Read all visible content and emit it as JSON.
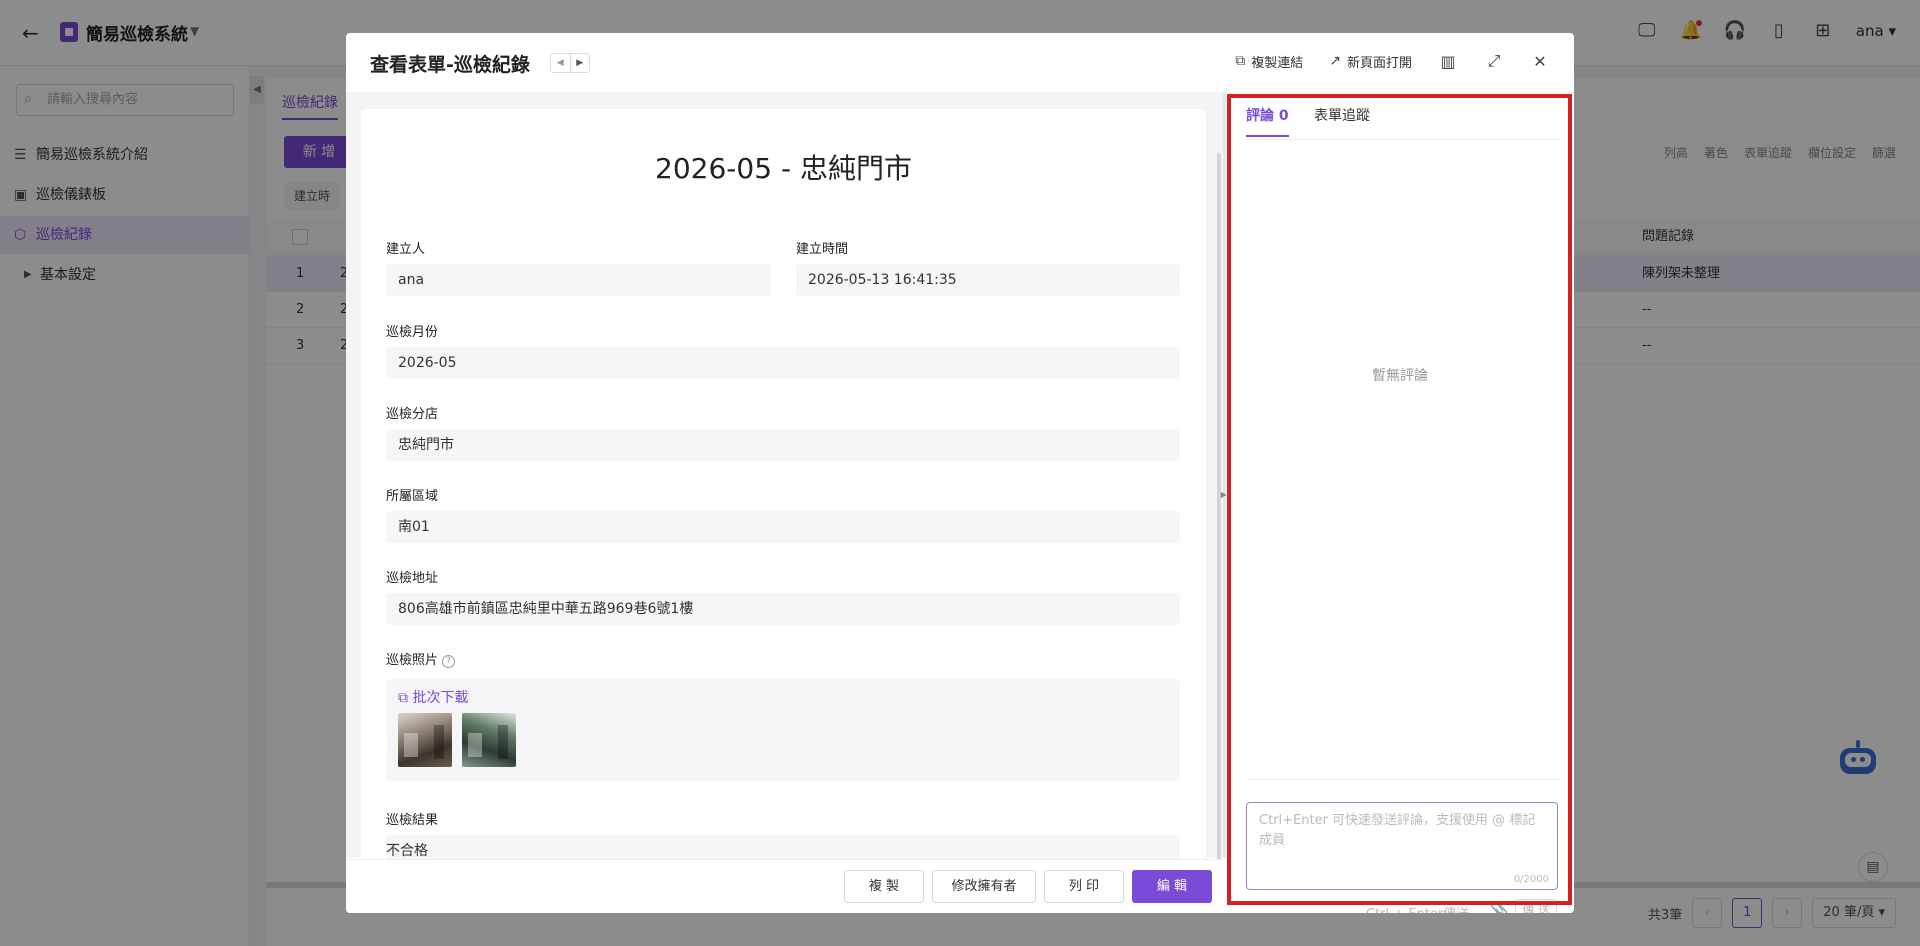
{
  "app": {
    "title": "簡易巡檢系統",
    "user": "ana"
  },
  "sidebar": {
    "search_placeholder": "請輸入搜尋內容",
    "items": [
      {
        "label": "簡易巡檢系統介紹"
      },
      {
        "label": "巡檢儀錶板"
      },
      {
        "label": "巡檢紀錄"
      },
      {
        "label": "基本設定"
      }
    ]
  },
  "content": {
    "tab": "巡檢紀錄",
    "add_button": "新 增",
    "filter_chip": "建立時",
    "tools": [
      "列高",
      "著色",
      "表單追蹤",
      "欄位設定",
      "篩選"
    ],
    "table": {
      "last_column_header": "問題記錄",
      "rows": [
        {
          "index": "1",
          "col2": "2",
          "issue": "陳列架未整理"
        },
        {
          "index": "2",
          "col2": "2",
          "issue": "--"
        },
        {
          "index": "3",
          "col2": "2",
          "issue": "--"
        }
      ]
    },
    "pager": {
      "total": "共3筆",
      "current": "1",
      "page_size": "20 筆/頁"
    }
  },
  "modal": {
    "title": "查看表單-巡檢紀錄",
    "actions": {
      "copy_link": "複製連結",
      "open_new_page": "新頁面打開"
    },
    "form": {
      "title": "2026-05 - 忠純門市",
      "creator_label": "建立人",
      "creator": "ana",
      "created_time_label": "建立時間",
      "created_time": "2026-05-13 16:41:35",
      "month_label": "巡檢月份",
      "month": "2026-05",
      "store_label": "巡檢分店",
      "store": "忠純門市",
      "region_label": "所屬區域",
      "region": "南01",
      "address_label": "巡檢地址",
      "address": "806高雄市前鎮區忠純里中華五路969巷6號1樓",
      "photos_label": "巡檢照片",
      "batch_download": "批次下載",
      "result_label": "巡檢結果",
      "result": "不合格"
    },
    "footer": {
      "copy": "複 製",
      "change_owner": "修改擁有者",
      "print": "列 印",
      "edit": "編 輯"
    },
    "comments": {
      "tab_comments": "評論 0",
      "tab_tracking": "表單追蹤",
      "empty": "暫無評論",
      "placeholder": "Ctrl+Enter 可快速發送評論，支援使用 @ 標記成員",
      "counter": "0/2000",
      "send_hint": "Ctrl + Enter傳送",
      "send_button": "傳 送"
    }
  },
  "colors": {
    "accent": "#7a4bd6",
    "highlight": "#d71f1f"
  },
  "icons": [
    "back-icon",
    "app-logo-icon",
    "caret-down-icon",
    "monitor-icon",
    "bell-icon",
    "headset-icon",
    "book-icon",
    "user-add-icon",
    "search-icon",
    "list-icon",
    "dashboard-icon",
    "cube-icon",
    "triangle-right-icon",
    "copy-icon",
    "external-link-icon",
    "side-panel-icon",
    "fullscreen-icon",
    "close-icon",
    "help-icon",
    "download-icon",
    "paperclip-icon",
    "robot-icon",
    "document-icon"
  ]
}
